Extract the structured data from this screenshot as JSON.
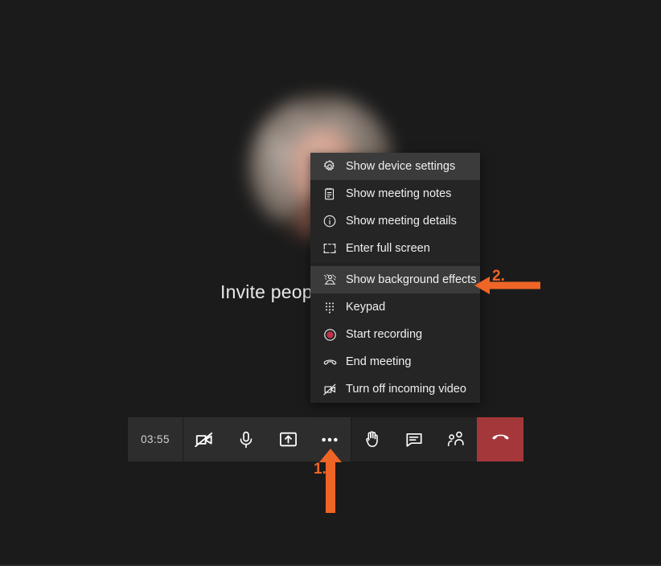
{
  "screen": {
    "background_color": "#1b1b1b",
    "invite_text": "Invite peop",
    "avatar_name": "blurred-participant-avatar"
  },
  "context_menu": {
    "items": [
      {
        "label": "Show device settings",
        "icon": "gear-icon",
        "highlighted": true,
        "separator_after": false
      },
      {
        "label": "Show meeting notes",
        "icon": "notes-icon",
        "highlighted": false,
        "separator_after": false
      },
      {
        "label": "Show meeting details",
        "icon": "info-circle-icon",
        "highlighted": false,
        "separator_after": false
      },
      {
        "label": "Enter full screen",
        "icon": "fullscreen-icon",
        "highlighted": false,
        "separator_after": true
      },
      {
        "label": "Show background effects",
        "icon": "background-effects-icon",
        "highlighted": true,
        "separator_after": false
      },
      {
        "label": "Keypad",
        "icon": "keypad-icon",
        "highlighted": false,
        "separator_after": false
      },
      {
        "label": "Start recording",
        "icon": "record-icon",
        "highlighted": false,
        "separator_after": false
      },
      {
        "label": "End meeting",
        "icon": "end-call-icon",
        "highlighted": false,
        "separator_after": false
      },
      {
        "label": "Turn off incoming video",
        "icon": "video-off-icon",
        "highlighted": false,
        "separator_after": false
      }
    ],
    "highlight_color": "#3b3b3b",
    "background_color": "#252525"
  },
  "toolbar": {
    "timer": "03:55",
    "buttons": [
      {
        "name": "camera-off-button",
        "icon": "video-off-icon"
      },
      {
        "name": "microphone-button",
        "icon": "microphone-icon"
      },
      {
        "name": "share-screen-button",
        "icon": "share-screen-icon"
      },
      {
        "name": "more-options-button",
        "icon": "ellipsis-icon"
      },
      {
        "name": "raise-hand-button",
        "icon": "hand-icon"
      },
      {
        "name": "chat-button",
        "icon": "chat-icon"
      },
      {
        "name": "people-button",
        "icon": "people-icon"
      },
      {
        "name": "hangup-button",
        "icon": "hangup-icon"
      }
    ],
    "hangup_color": "#a4373a"
  },
  "annotations": {
    "accent_color": "#ef6526",
    "step1": {
      "label": "1.",
      "points_to": "more-options-button",
      "direction": "up"
    },
    "step2": {
      "label": "2.",
      "points_to": "Show background effects",
      "direction": "left"
    }
  }
}
